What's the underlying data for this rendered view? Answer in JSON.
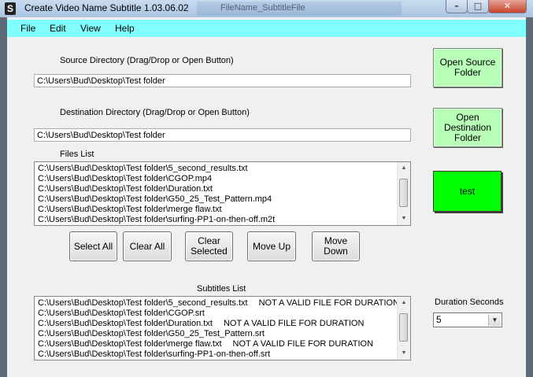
{
  "window": {
    "title": "Create Video Name Subtitle 1.03.06.02",
    "app_icon": "S",
    "background_window_title": "FileName_SubtitleFile",
    "controls": {
      "minimize": "–",
      "maximize": "□",
      "close": "✕"
    }
  },
  "menu": {
    "items": [
      "File",
      "Edit",
      "View",
      "Help"
    ]
  },
  "source": {
    "label": "Source Directory (Drag/Drop or Open Button)",
    "value": "C:\\Users\\Bud\\Desktop\\Test folder",
    "open_button": "Open Source\nFolder"
  },
  "destination": {
    "label": "Destination Directory (Drag/Drop or Open Button)",
    "value": "C:\\Users\\Bud\\Desktop\\Test folder",
    "open_button": "Open\nDestination\nFolder"
  },
  "files_list": {
    "label": "Files List",
    "items": [
      "C:\\Users\\Bud\\Desktop\\Test folder\\5_second_results.txt",
      "C:\\Users\\Bud\\Desktop\\Test folder\\CGOP.mp4",
      "C:\\Users\\Bud\\Desktop\\Test folder\\Duration.txt",
      "C:\\Users\\Bud\\Desktop\\Test folder\\G50_25_Test_Pattern.mp4",
      "C:\\Users\\Bud\\Desktop\\Test folder\\merge flaw.txt",
      "C:\\Users\\Bud\\Desktop\\Test folder\\surfing-PP1-on-then-off.m2t"
    ]
  },
  "test_button": "test",
  "buttons": {
    "select_all": "Select All",
    "clear_all": "Clear All",
    "clear_selected": "Clear\nSelected",
    "move_up": "Move Up",
    "move_down": "Move\nDown"
  },
  "subtitles_list": {
    "label": "Subtitles List",
    "items": [
      {
        "path": "C:\\Users\\Bud\\Desktop\\Test folder\\5_second_results.txt",
        "note": "NOT A VALID FILE FOR DURATION"
      },
      {
        "path": "C:\\Users\\Bud\\Desktop\\Test folder\\CGOP.srt",
        "note": ""
      },
      {
        "path": "C:\\Users\\Bud\\Desktop\\Test folder\\Duration.txt",
        "note": "NOT A VALID FILE FOR DURATION"
      },
      {
        "path": "C:\\Users\\Bud\\Desktop\\Test folder\\G50_25_Test_Pattern.srt",
        "note": ""
      },
      {
        "path": "C:\\Users\\Bud\\Desktop\\Test folder\\merge flaw.txt",
        "note": "NOT A VALID FILE FOR DURATION"
      },
      {
        "path": "C:\\Users\\Bud\\Desktop\\Test folder\\surfing-PP1-on-then-off.srt",
        "note": ""
      }
    ]
  },
  "duration": {
    "label": "Duration Seconds",
    "value": "5"
  },
  "colors": {
    "menu_bar": "#80ffff",
    "open_buttons": "#b8ffb8",
    "test_button": "#00ff00"
  }
}
